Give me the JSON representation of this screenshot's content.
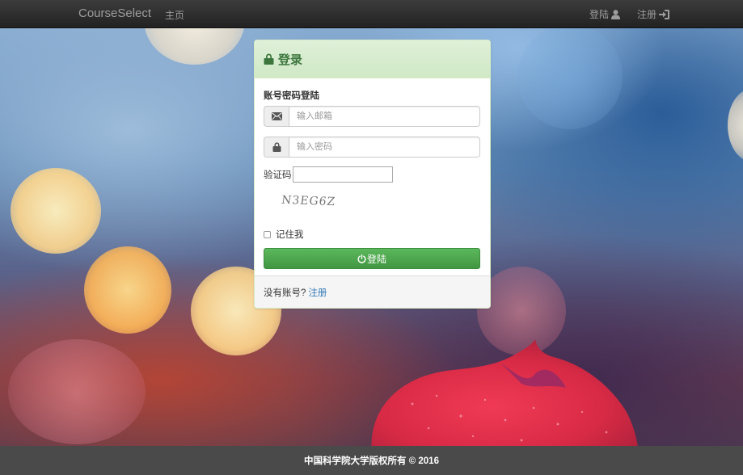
{
  "navbar": {
    "brand": "CourseSelect",
    "home_link": "主页",
    "login_link": "登陆",
    "register_link": "注册",
    "login_icon": "user-icon",
    "register_icon": "log-in-icon"
  },
  "panel": {
    "title": "登录",
    "title_icon": "lock-icon",
    "section_label": "账号密码登陆",
    "email": {
      "icon": "envelope-icon",
      "placeholder": "输入邮箱",
      "value": ""
    },
    "password": {
      "icon": "lock-icon",
      "placeholder": "输入密码",
      "value": ""
    },
    "captcha_label": "验证码",
    "captcha_value": "",
    "captcha_image_text": "N3EG6Z",
    "remember_label": "记住我",
    "remember_checked": false,
    "submit_label": "登陆",
    "submit_icon": "power-off-icon",
    "footer_text": "没有账号?",
    "footer_link": "注册"
  },
  "footer": {
    "copyright": "中国科学院大学版权所有 © 2016"
  },
  "colors": {
    "navbar_bg": "#222222",
    "panel_heading_bg": "#dff0d8",
    "panel_heading_text": "#3c763d",
    "primary_button": "#5cb85c",
    "link": "#337ab7",
    "footer_bg": "#4a4a4a"
  }
}
